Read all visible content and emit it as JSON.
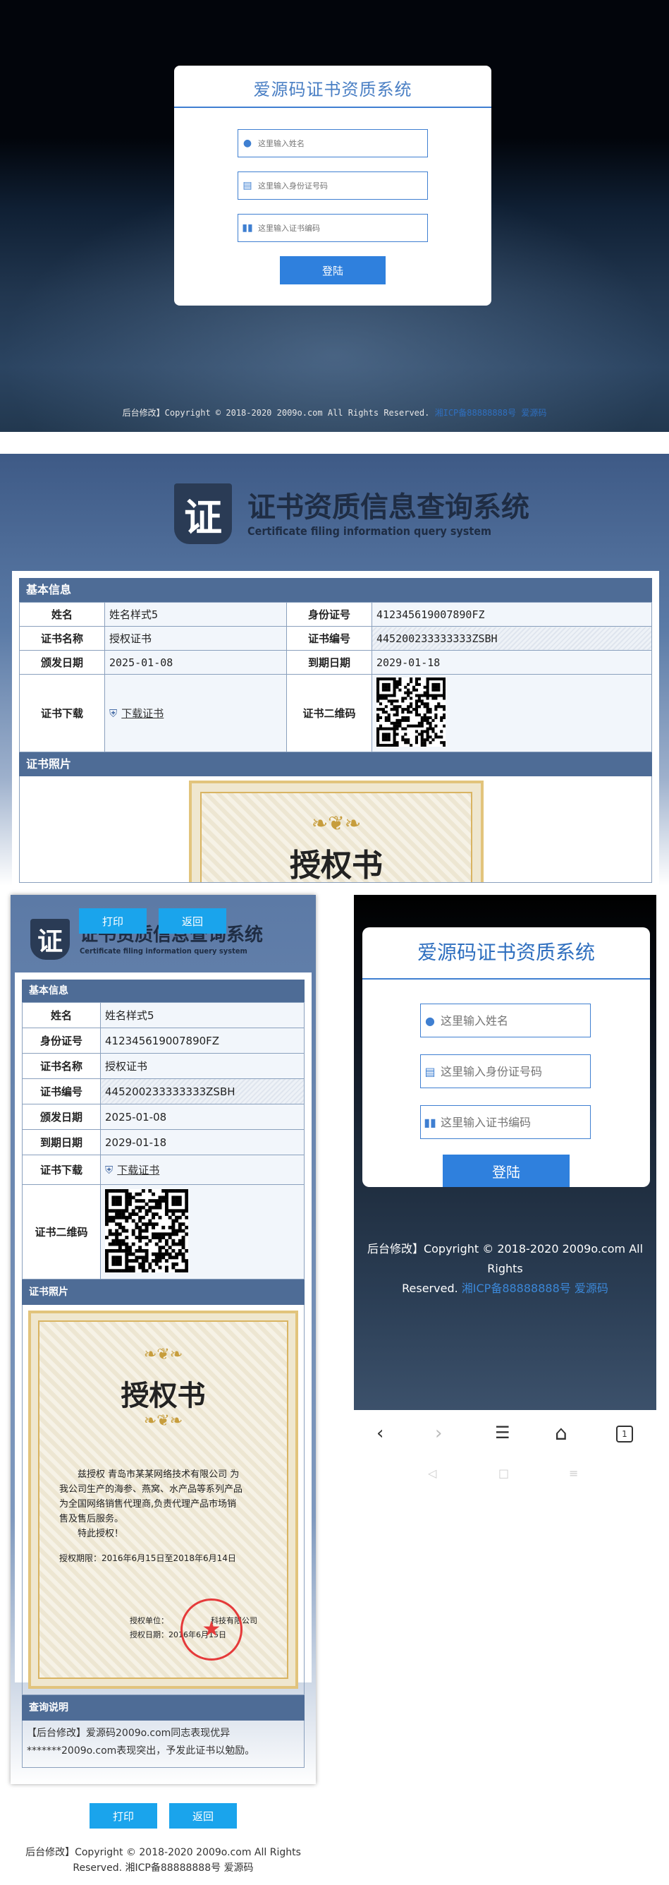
{
  "login": {
    "title": "爱源码证书资质系统",
    "name_placeholder": "这里输入姓名",
    "id_placeholder": "这里输入身份证号码",
    "cert_placeholder": "这里输入证书编码",
    "submit": "登陆"
  },
  "footer_desktop": {
    "prefix": "后台修改】Copyright © 2018-2020 2009o.com All Rights Reserved.",
    "icp": "湘ICP备88888888号",
    "brand": "爱源码"
  },
  "brand": {
    "logo_char": "证",
    "title": "证书资质信息查询系统",
    "subtitle": "Certificate filing information query system"
  },
  "sections": {
    "basic": "基本信息",
    "photo": "证书照片",
    "desc": "查询说明"
  },
  "fields": {
    "name_label": "姓名",
    "name_value": "姓名样式5",
    "idcard_label": "身份证号",
    "idcard_value": "412345619007890FZ",
    "cert_name_label": "证书名称",
    "cert_name_value": "授权证书",
    "cert_no_label": "证书编号",
    "cert_no_value": "445200233333333ZSBH",
    "issue_label": "颁发日期",
    "issue_value": "2025-01-08",
    "expire_label": "到期日期",
    "expire_value": "2029-01-18",
    "download_label": "证书下载",
    "download_link": "下载证书",
    "qr_label": "证书二维码"
  },
  "certificate": {
    "title": "授权书",
    "line1": "兹授权 青岛市某某网络技术有限公司 为",
    "line2": "我公司生产的海参、燕窝、水产品等系列产品",
    "line3": "为全国网络销售代理商,负责代理产品市场销",
    "line4": "售及售后服务。",
    "line5": "特此授权！",
    "period": "授权期限：2016年6月15日至2018年6月14日",
    "unit": "授权单位：",
    "unit_company": "科技有限公司",
    "date": "授权日期：2016年6月15日"
  },
  "description": "【后台修改】爱源码2009o.com同志表现优异*******2009o.com表现突出，予发此证书以勉励。",
  "actions": {
    "print": "打印",
    "back": "返回"
  },
  "footer_mobile": {
    "line1": "后台修改】Copyright © 2018-2020 2009o.com All Rights",
    "line2_prefix": "Reserved.",
    "icp": "湘ICP备88888888号",
    "brand": "爱源码"
  },
  "mobile_footer": {
    "line1": "后台修改】Copyright © 2018-2020 2009o.com All Rights",
    "line2_prefix": "Reserved.",
    "icp": "湘ICP备88888888号",
    "brand": "爱源码"
  },
  "browser_nav": {
    "tab_count": "1"
  },
  "colors": {
    "accent": "#2f80dd",
    "header_bar": "#4e6c96",
    "print_button": "#1aa4ec"
  }
}
